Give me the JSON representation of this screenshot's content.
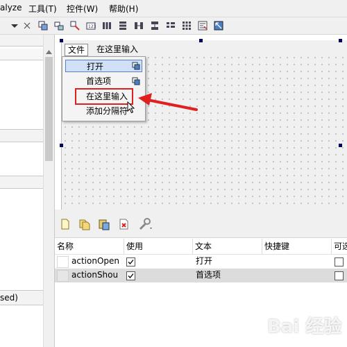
{
  "menubar": {
    "items": [
      "alyze",
      "工具(T)",
      "控件(W)",
      "帮助(H)"
    ]
  },
  "left_panel": {
    "bottom_label": "sed)"
  },
  "form_menubar": {
    "tabs": [
      "文件",
      "在这里输入"
    ]
  },
  "popup_menu": {
    "items": [
      "打开",
      "首选项",
      "在这里输入",
      "添加分隔符"
    ]
  },
  "action_table": {
    "headers": [
      "名称",
      "使用",
      "文本",
      "快捷键",
      "可选"
    ],
    "rows": [
      {
        "name": "actionOpen",
        "used": true,
        "text": "打开"
      },
      {
        "name": "actionShou",
        "used": true,
        "text": "首选项"
      }
    ]
  },
  "colors": {
    "highlight_box": "#e02020",
    "arrow": "#e02020",
    "selected_row": "#dcdcdc",
    "hover_item": "#cfe0f7"
  },
  "watermark": "Bai 经验"
}
